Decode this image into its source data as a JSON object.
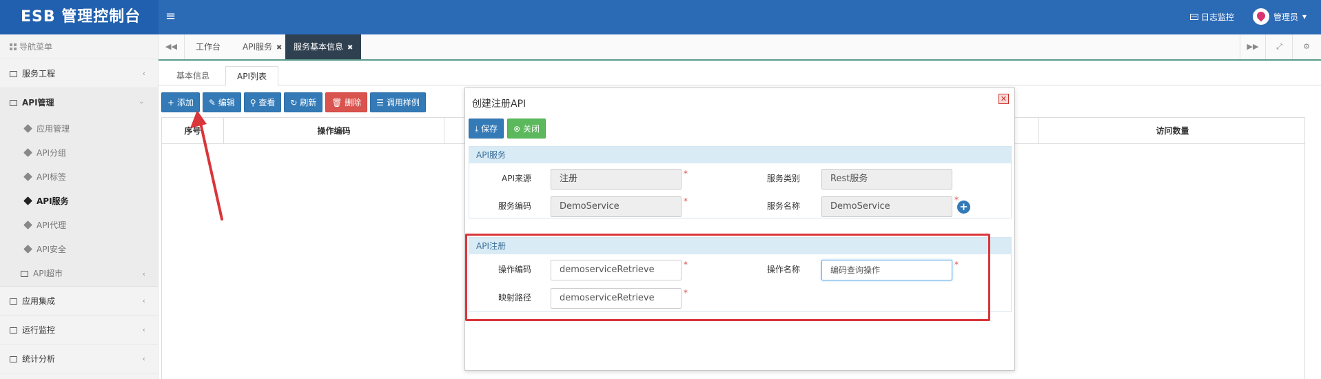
{
  "header": {
    "brand": "ESB 管理控制台",
    "menu_toggle": "≡",
    "log_monitor": "日志监控",
    "user_name": "管理员",
    "user_caret": "▾"
  },
  "sidebar": {
    "title": "导航菜单",
    "menus": [
      {
        "label": "服务工程",
        "chevron": "‹"
      },
      {
        "label": "API管理",
        "chevron": "›"
      },
      {
        "label": "应用集成",
        "chevron": "‹"
      },
      {
        "label": "运行监控",
        "chevron": "‹"
      },
      {
        "label": "统计分析",
        "chevron": "‹"
      }
    ],
    "api_sub": [
      {
        "label": "应用管理"
      },
      {
        "label": "API分组"
      },
      {
        "label": "API标签"
      },
      {
        "label": "API服务"
      },
      {
        "label": "API代理"
      },
      {
        "label": "API安全"
      },
      {
        "label": "API超市",
        "chevron": "‹"
      }
    ]
  },
  "tabbar": {
    "prev": "◀◀",
    "next": "▶▶",
    "expand": "⤢",
    "settings": "⚙",
    "tabs": [
      {
        "label": "工作台",
        "close": ""
      },
      {
        "label": "API服务",
        "close": "✖"
      },
      {
        "label": "服务基本信息",
        "close": "✖"
      }
    ]
  },
  "subtabs": [
    "基本信息",
    "API列表"
  ],
  "toolbar": {
    "add": "+ 添加",
    "edit": "✎ 编辑",
    "view": "⚲ 查看",
    "refresh": "↻ 刷新",
    "delete": "🗑 删除",
    "call_example": "☰ 调用样例"
  },
  "table": {
    "columns": [
      "序号",
      "操作编码",
      "访问数量"
    ]
  },
  "dialog": {
    "title": "创建注册API",
    "close": "✕",
    "save": "⤓ 保存",
    "close_btn": "⊗ 关闭",
    "section_service": {
      "title": "API服务",
      "api_source_label": "API来源",
      "api_source_value": "注册",
      "service_type_label": "服务类别",
      "service_type_value": "Rest服务",
      "service_code_label": "服务编码",
      "service_code_value": "DemoService",
      "service_name_label": "服务名称",
      "service_name_value": "DemoService",
      "add_icon": "+"
    },
    "section_register": {
      "title": "API注册",
      "op_code_label": "操作编码",
      "op_code_value": "demoserviceRetrieve",
      "op_name_label": "操作名称",
      "op_name_value": "编码查询操作",
      "map_path_label": "映射路径",
      "map_path_value": "demoserviceRetrieve"
    },
    "required_mark": "*"
  },
  "colors": {
    "header_bg": "#2b6ab5",
    "primary": "#337ab7",
    "danger": "#d9534f",
    "success": "#5cb85c",
    "annotation": "#d9353a"
  }
}
